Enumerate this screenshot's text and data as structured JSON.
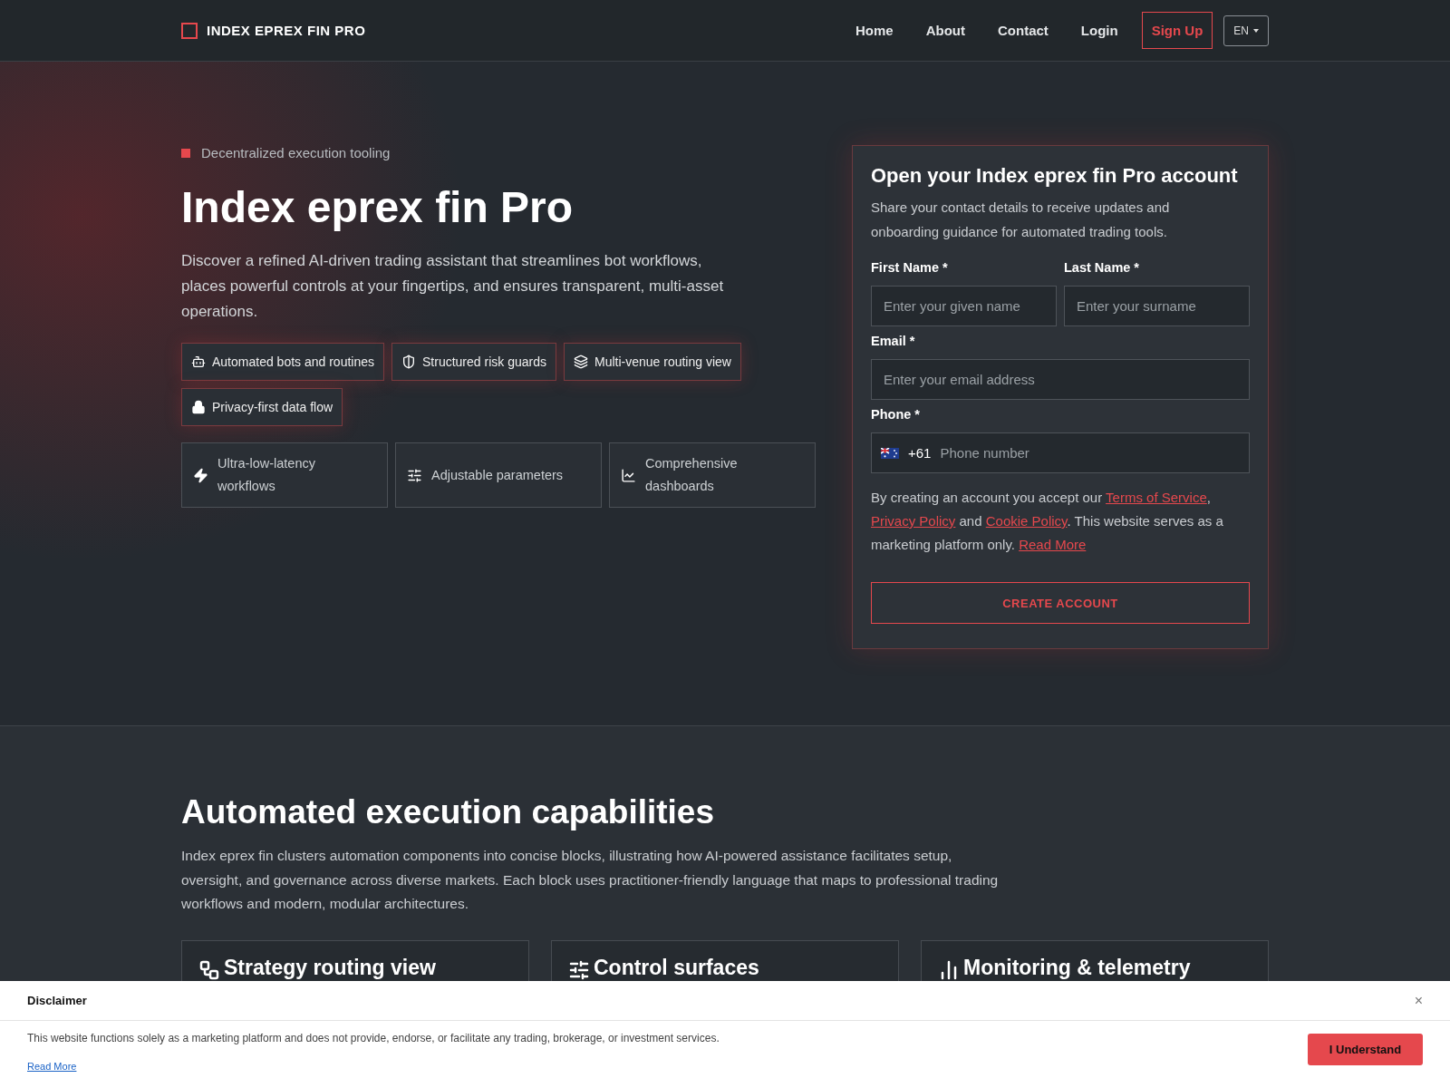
{
  "nav": {
    "brand": "INDEX EPREX FIN PRO",
    "links": [
      {
        "label": "Home"
      },
      {
        "label": "About"
      },
      {
        "label": "Contact"
      },
      {
        "label": "Login"
      }
    ],
    "signup": "Sign Up",
    "language": "EN"
  },
  "hero": {
    "eyebrow": "Decentralized execution tooling",
    "title": "Index eprex fin Pro",
    "description": "Discover a refined AI-driven trading assistant that streamlines bot workflows, places powerful controls at your fingertips, and ensures transparent, multi-asset operations.",
    "tags": [
      "Automated bots and routines",
      "Structured risk guards",
      "Multi-venue routing view",
      "Privacy-first data flow"
    ],
    "features": [
      "Ultra-low-latency workflows",
      "Adjustable parameters",
      "Comprehensive dashboards"
    ]
  },
  "form": {
    "title": "Open your Index eprex fin Pro account",
    "subtitle": "Share your contact details to receive updates and onboarding guidance for automated trading tools.",
    "name_fields": [
      {
        "label": "First Name *",
        "placeholder": "Enter your given name"
      },
      {
        "label": "Last Name *",
        "placeholder": "Enter your surname"
      }
    ],
    "email": {
      "label": "Email *",
      "placeholder": "Enter your email address"
    },
    "phone": {
      "label": "Phone *",
      "prefix": "+61",
      "placeholder": "Phone number"
    },
    "consent": [
      {
        "kind": "text",
        "text": "By creating an account you accept our "
      },
      {
        "kind": "link",
        "text": "Terms of Service"
      },
      {
        "kind": "text",
        "text": ", "
      },
      {
        "kind": "link",
        "text": "Privacy Policy"
      },
      {
        "kind": "text",
        "text": " and "
      },
      {
        "kind": "link",
        "text": "Cookie Policy"
      },
      {
        "kind": "text",
        "text": ". This website serves as a marketing platform only. "
      },
      {
        "kind": "link",
        "text": "Read More"
      }
    ],
    "button": "CREATE ACCOUNT"
  },
  "capabilities": {
    "title": "Automated execution capabilities",
    "description": "Index eprex fin clusters automation components into concise blocks, illustrating how AI-powered assistance facilitates setup, oversight, and governance across diverse markets. Each block uses practitioner-friendly language that maps to professional trading workflows and modern, modular architectures.",
    "cards": [
      {
        "title": "Strategy routing view"
      },
      {
        "title": "Control surfaces"
      },
      {
        "title": "Monitoring & telemetry"
      }
    ]
  },
  "disclaimer": {
    "title": "Disclaimer",
    "close": "×",
    "text": "This website functions solely as a marketing platform and does not provide, endorse, or facilitate any trading, brokerage, or investment services.",
    "link": "Read More",
    "button": "I Understand"
  }
}
